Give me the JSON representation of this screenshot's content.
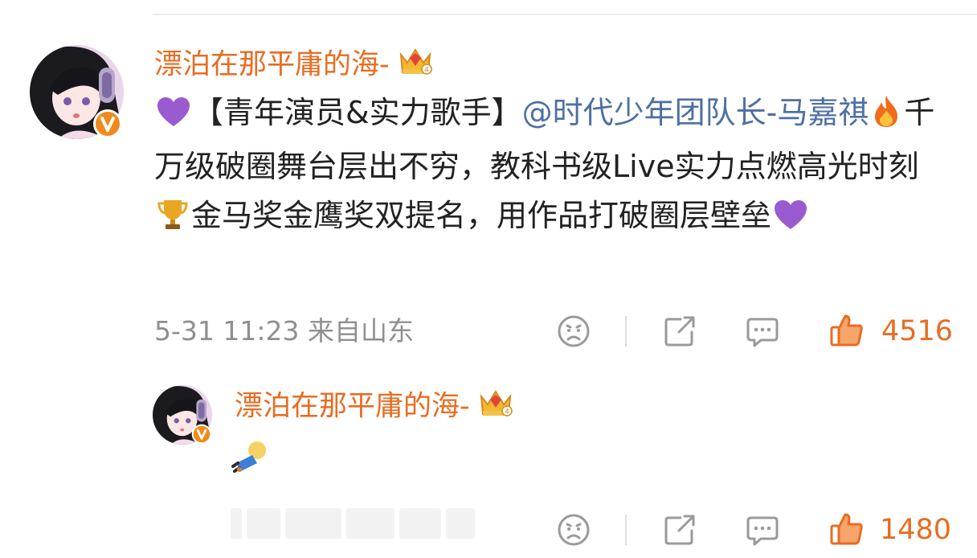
{
  "post": {
    "username": "漂泊在那平庸的海-",
    "content_segments": [
      {
        "type": "text",
        "text": "【青年演员&实力歌手】"
      },
      {
        "type": "mention",
        "text": "@时代少年团队长-马嘉祺"
      },
      {
        "type": "text",
        "text": "千万级破圈舞台层出不穷，教科书级Live实力点燃高光时刻"
      },
      {
        "type": "text",
        "text": "金马奖金鹰奖双提名，用作品打破圈层壁垒"
      }
    ],
    "timestamp": "5-31 11:23",
    "location": "来自山东",
    "likes": "4516"
  },
  "reply": {
    "username": "漂泊在那平庸的海-",
    "likes": "1480"
  },
  "icons": {
    "heart": "purple-heart-icon",
    "fire": "fire-icon",
    "trophy": "trophy-icon",
    "crown": "crown-badge-icon",
    "verified": "verified-v-icon"
  },
  "colors": {
    "username": "#e86c21",
    "mention": "#4e6fa3",
    "like": "#e86c21",
    "meta": "#8f8f8f",
    "icon_gray": "#9a9a9a"
  }
}
